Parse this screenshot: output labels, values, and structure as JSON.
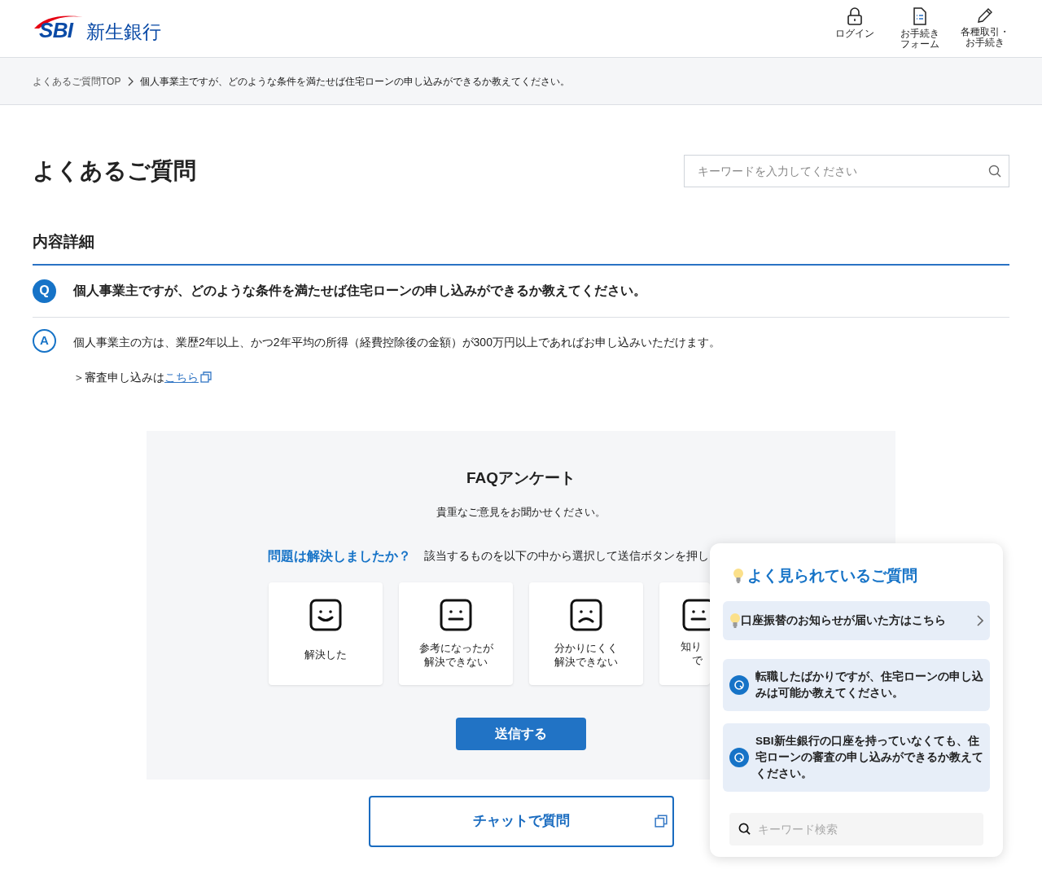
{
  "header": {
    "logo": {
      "mark": "SBI",
      "name": "新生銀行"
    },
    "nav": [
      {
        "kind": "lock",
        "lines": [
          "ログイン"
        ]
      },
      {
        "kind": "form",
        "lines": [
          "お手続き",
          "フォーム"
        ]
      },
      {
        "kind": "pen",
        "lines": [
          "各種取引・",
          "お手続き"
        ]
      }
    ]
  },
  "breadcrumb": [
    "よくあるご質問TOP",
    "個人事業主ですが、どのような条件を満たせば住宅ローンの申し込みができるか教えてください。"
  ],
  "page_title": "よくあるご質問",
  "search": {
    "placeholder": "キーワードを入力してください"
  },
  "section_title": "内容詳細",
  "question": {
    "mark": "Q",
    "text": "個人事業主ですが、どのような条件を満たせば住宅ローンの申し込みができるか教えてください。"
  },
  "answer": {
    "mark": "A",
    "text": "個人事業主の方は、業歴2年以上、かつ2年平均の所得（経費控除後の金額）が300万円以上であればお申し込みいただけます。",
    "link_prefix": "＞審査申し込みは",
    "link": "こちら"
  },
  "survey": {
    "title": "FAQアンケート",
    "subtitle": "貴重なご意見をお聞かせください。",
    "question": "問題は解決しましたか？",
    "instruction": "該当するものを以下の中から選択して送信ボタンを押し",
    "options": [
      {
        "kind": "smile",
        "lines": [
          "解決した"
        ]
      },
      {
        "kind": "neutral",
        "lines": [
          "参考になったが",
          "解決できない"
        ]
      },
      {
        "kind": "frown",
        "lines": [
          "分かりにくく",
          "解決できない"
        ]
      },
      {
        "kind": "partial",
        "lines": [
          "知り",
          "で"
        ]
      }
    ],
    "submit": "送信する"
  },
  "chat_button": "チャットで質問",
  "popular_panel": {
    "title": "よく見られているご質問",
    "items": [
      {
        "kind": "notice",
        "text": "口座振替のお知らせが届いた方はこちら"
      },
      {
        "kind": "question",
        "text": "転職したばかりですが、住宅ローンの申し込みは可能か教えてください。"
      },
      {
        "kind": "question",
        "text": "SBI新生銀行の口座を持っていなくても、住宅ローンの審査の申し込みができるか教えてください。"
      }
    ],
    "search_placeholder": "キーワード検索"
  }
}
